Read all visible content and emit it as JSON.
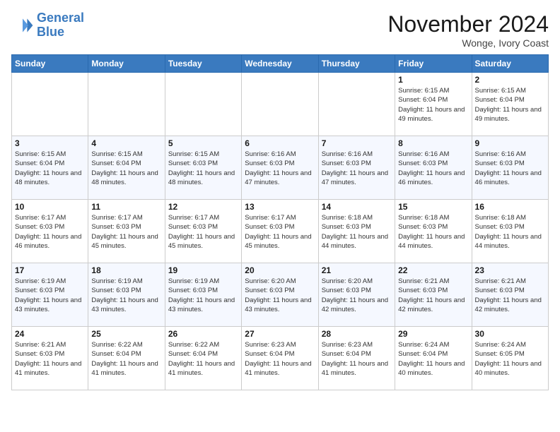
{
  "header": {
    "logo_line1": "General",
    "logo_line2": "Blue",
    "month": "November 2024",
    "location": "Wonge, Ivory Coast"
  },
  "weekdays": [
    "Sunday",
    "Monday",
    "Tuesday",
    "Wednesday",
    "Thursday",
    "Friday",
    "Saturday"
  ],
  "weeks": [
    [
      {
        "day": "",
        "info": ""
      },
      {
        "day": "",
        "info": ""
      },
      {
        "day": "",
        "info": ""
      },
      {
        "day": "",
        "info": ""
      },
      {
        "day": "",
        "info": ""
      },
      {
        "day": "1",
        "info": "Sunrise: 6:15 AM\nSunset: 6:04 PM\nDaylight: 11 hours and 49 minutes."
      },
      {
        "day": "2",
        "info": "Sunrise: 6:15 AM\nSunset: 6:04 PM\nDaylight: 11 hours and 49 minutes."
      }
    ],
    [
      {
        "day": "3",
        "info": "Sunrise: 6:15 AM\nSunset: 6:04 PM\nDaylight: 11 hours and 48 minutes."
      },
      {
        "day": "4",
        "info": "Sunrise: 6:15 AM\nSunset: 6:04 PM\nDaylight: 11 hours and 48 minutes."
      },
      {
        "day": "5",
        "info": "Sunrise: 6:15 AM\nSunset: 6:03 PM\nDaylight: 11 hours and 48 minutes."
      },
      {
        "day": "6",
        "info": "Sunrise: 6:16 AM\nSunset: 6:03 PM\nDaylight: 11 hours and 47 minutes."
      },
      {
        "day": "7",
        "info": "Sunrise: 6:16 AM\nSunset: 6:03 PM\nDaylight: 11 hours and 47 minutes."
      },
      {
        "day": "8",
        "info": "Sunrise: 6:16 AM\nSunset: 6:03 PM\nDaylight: 11 hours and 46 minutes."
      },
      {
        "day": "9",
        "info": "Sunrise: 6:16 AM\nSunset: 6:03 PM\nDaylight: 11 hours and 46 minutes."
      }
    ],
    [
      {
        "day": "10",
        "info": "Sunrise: 6:17 AM\nSunset: 6:03 PM\nDaylight: 11 hours and 46 minutes."
      },
      {
        "day": "11",
        "info": "Sunrise: 6:17 AM\nSunset: 6:03 PM\nDaylight: 11 hours and 45 minutes."
      },
      {
        "day": "12",
        "info": "Sunrise: 6:17 AM\nSunset: 6:03 PM\nDaylight: 11 hours and 45 minutes."
      },
      {
        "day": "13",
        "info": "Sunrise: 6:17 AM\nSunset: 6:03 PM\nDaylight: 11 hours and 45 minutes."
      },
      {
        "day": "14",
        "info": "Sunrise: 6:18 AM\nSunset: 6:03 PM\nDaylight: 11 hours and 44 minutes."
      },
      {
        "day": "15",
        "info": "Sunrise: 6:18 AM\nSunset: 6:03 PM\nDaylight: 11 hours and 44 minutes."
      },
      {
        "day": "16",
        "info": "Sunrise: 6:18 AM\nSunset: 6:03 PM\nDaylight: 11 hours and 44 minutes."
      }
    ],
    [
      {
        "day": "17",
        "info": "Sunrise: 6:19 AM\nSunset: 6:03 PM\nDaylight: 11 hours and 43 minutes."
      },
      {
        "day": "18",
        "info": "Sunrise: 6:19 AM\nSunset: 6:03 PM\nDaylight: 11 hours and 43 minutes."
      },
      {
        "day": "19",
        "info": "Sunrise: 6:19 AM\nSunset: 6:03 PM\nDaylight: 11 hours and 43 minutes."
      },
      {
        "day": "20",
        "info": "Sunrise: 6:20 AM\nSunset: 6:03 PM\nDaylight: 11 hours and 43 minutes."
      },
      {
        "day": "21",
        "info": "Sunrise: 6:20 AM\nSunset: 6:03 PM\nDaylight: 11 hours and 42 minutes."
      },
      {
        "day": "22",
        "info": "Sunrise: 6:21 AM\nSunset: 6:03 PM\nDaylight: 11 hours and 42 minutes."
      },
      {
        "day": "23",
        "info": "Sunrise: 6:21 AM\nSunset: 6:03 PM\nDaylight: 11 hours and 42 minutes."
      }
    ],
    [
      {
        "day": "24",
        "info": "Sunrise: 6:21 AM\nSunset: 6:03 PM\nDaylight: 11 hours and 41 minutes."
      },
      {
        "day": "25",
        "info": "Sunrise: 6:22 AM\nSunset: 6:04 PM\nDaylight: 11 hours and 41 minutes."
      },
      {
        "day": "26",
        "info": "Sunrise: 6:22 AM\nSunset: 6:04 PM\nDaylight: 11 hours and 41 minutes."
      },
      {
        "day": "27",
        "info": "Sunrise: 6:23 AM\nSunset: 6:04 PM\nDaylight: 11 hours and 41 minutes."
      },
      {
        "day": "28",
        "info": "Sunrise: 6:23 AM\nSunset: 6:04 PM\nDaylight: 11 hours and 41 minutes."
      },
      {
        "day": "29",
        "info": "Sunrise: 6:24 AM\nSunset: 6:04 PM\nDaylight: 11 hours and 40 minutes."
      },
      {
        "day": "30",
        "info": "Sunrise: 6:24 AM\nSunset: 6:05 PM\nDaylight: 11 hours and 40 minutes."
      }
    ]
  ]
}
